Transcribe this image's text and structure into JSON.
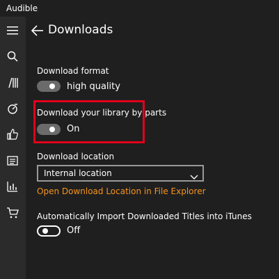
{
  "app": {
    "title": "Audible"
  },
  "page": {
    "title": "Downloads"
  },
  "sidebar": {
    "items": [
      {
        "icon": "hamburger-menu-icon"
      },
      {
        "icon": "search-icon"
      },
      {
        "icon": "library-icon"
      },
      {
        "icon": "discover-icon"
      },
      {
        "icon": "thumbs-up-icon"
      },
      {
        "icon": "list-icon"
      },
      {
        "icon": "stats-icon"
      },
      {
        "icon": "cart-icon"
      }
    ]
  },
  "settings": {
    "download_format": {
      "label": "Download format",
      "state": "on",
      "value": "high quality"
    },
    "by_parts": {
      "label": "Download your library by parts",
      "state": "on",
      "value": "On"
    },
    "location": {
      "label": "Download location",
      "selected": "Internal location",
      "link": "Open Download Location in File Explorer"
    },
    "itunes": {
      "label": "Automatically Import Downloaded Titles into iTunes",
      "state": "off",
      "value": "Off"
    }
  },
  "colors": {
    "background": "#1f1f1f",
    "sidebar": "#2b2b2b",
    "link": "#f7941d",
    "highlight": "#e2001a"
  }
}
